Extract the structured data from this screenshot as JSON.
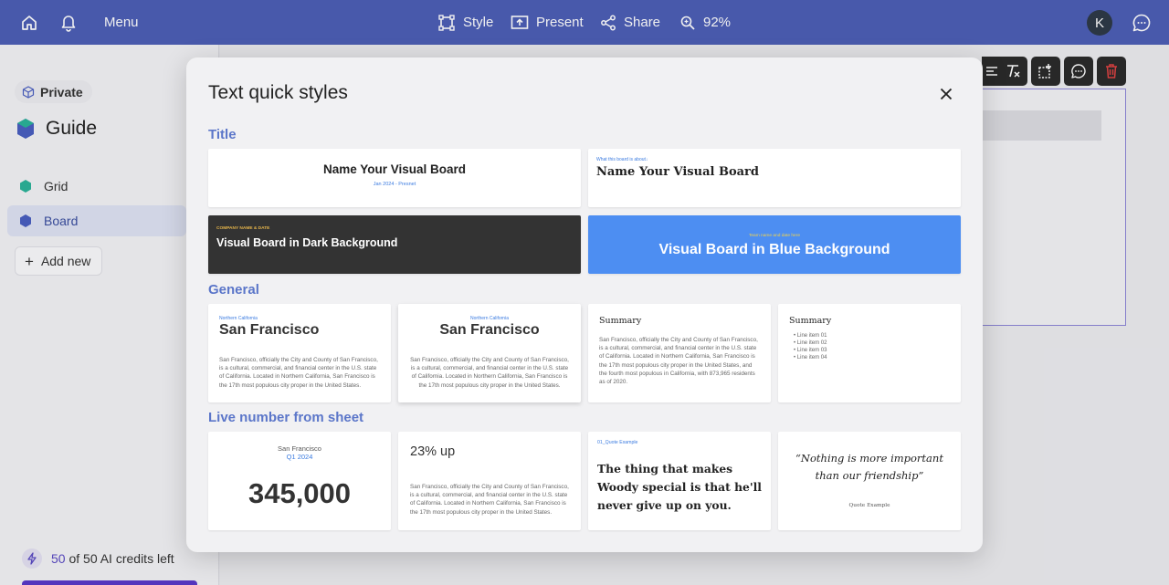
{
  "topbar": {
    "menu_label": "Menu",
    "style_label": "Style",
    "present_label": "Present",
    "share_label": "Share",
    "zoom_label": "92%",
    "avatar_initial": "K"
  },
  "sidebar": {
    "private_label": "Private",
    "workspace_title": "Guide",
    "items": [
      {
        "label": "Grid",
        "color": "#2bb39a"
      },
      {
        "label": "Board",
        "color": "#4a5fc1"
      }
    ],
    "add_new_label": "Add new",
    "credits_count": "50",
    "credits_rest": "of 50 AI credits left"
  },
  "modal": {
    "title": "Text quick styles",
    "sections": {
      "title": "Title",
      "general": "General",
      "live": "Live number from sheet"
    },
    "title_cards": {
      "c1": {
        "heading": "Name Your Visual Board",
        "sub": "Jan 2024 - Presnet"
      },
      "c2": {
        "eyebrow": "What this board is about↓",
        "heading": "Name Your Visual Board"
      },
      "c3": {
        "eyebrow": "COMPANY NAME & DATE",
        "heading": "Visual Board in Dark Background"
      },
      "c4": {
        "eyebrow": "Team name and date here",
        "heading": "Visual Board in Blue Background"
      }
    },
    "general_cards": {
      "g1": {
        "eyebrow": "Northern California",
        "heading": "San Francisco",
        "body": "San Francisco, officially the City and County of San Francisco, is a cultural, commercial, and financial center in the U.S. state of California. Located in Northern California, San Francisco is the 17th most populous city proper in the United States."
      },
      "g2": {
        "eyebrow": "Northern California",
        "heading": "San Francisco",
        "body": "San Francisco, officially the City and County of San Francisco, is a cultural, commercial, and financial center in the U.S. state of California. Located in Northern California, San Francisco is the 17th most populous city proper in the United States."
      },
      "g3": {
        "heading": "Summary",
        "body": "San Francisco, officially the City and County of San Francisco, is a cultural, commercial, and financial center in the U.S. state of California. Located in Northern California, San Francisco is the 17th most populous city proper in the United States, and the fourth most populous in California, with 873,965 residents as of 2020."
      },
      "g4": {
        "heading": "Summary",
        "items": [
          "Line item 01",
          "Line item 02",
          "Line item 03",
          "Line item 04"
        ]
      }
    },
    "live_cards": {
      "l1": {
        "city": "San Francisco",
        "period": "Q1 2024",
        "number": "345,000"
      },
      "l2": {
        "heading": "23% up",
        "body": "San Francisco, officially the City and County of San Francisco, is a cultural, commercial, and financial center in the U.S. state of California. Located in Northern California, San Francisco is the 17th most populous city proper in the United States."
      },
      "l3": {
        "eyebrow": "01_Quote Example",
        "quote": "The thing that makes Woody special is that he'll never give up on you."
      },
      "l4": {
        "quote": "“Nothing is more important than our friendship”",
        "caption": "Quote Example"
      }
    }
  },
  "colors": {
    "topbar": "#4d5fb6",
    "accent_section": "#5b76c9",
    "dark_card": "#333333",
    "blue_card": "#4d8ef2",
    "delete_icon": "#e04343"
  }
}
